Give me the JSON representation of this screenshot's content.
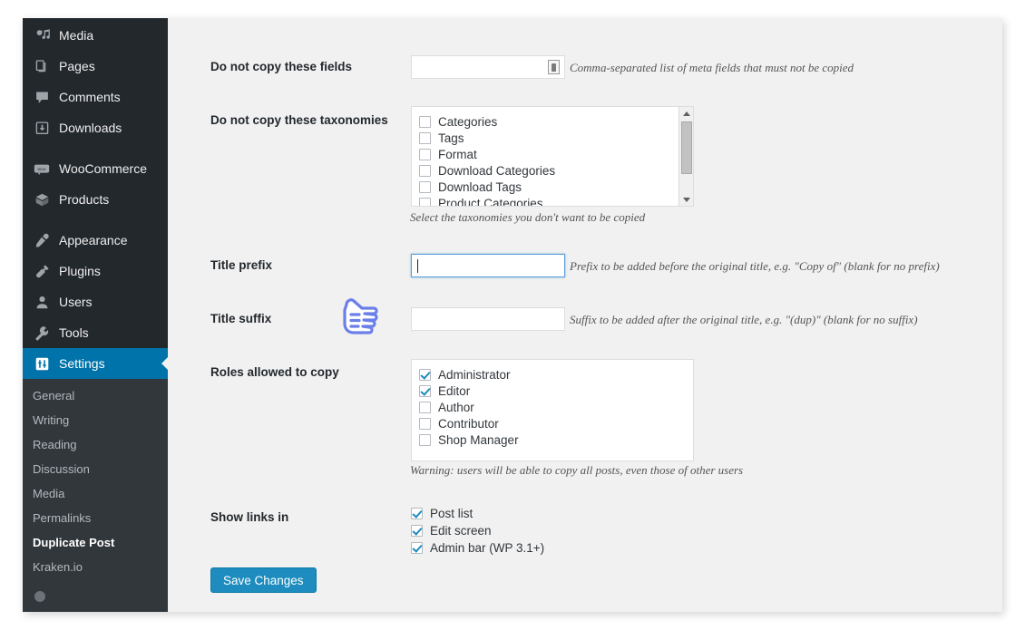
{
  "sidebar": {
    "items": [
      {
        "label": "Media",
        "icon": "media-icon"
      },
      {
        "label": "Pages",
        "icon": "pages-icon"
      },
      {
        "label": "Comments",
        "icon": "comments-icon"
      },
      {
        "label": "Downloads",
        "icon": "downloads-icon"
      },
      {
        "label": "WooCommerce",
        "icon": "woocommerce-icon"
      },
      {
        "label": "Products",
        "icon": "products-icon"
      },
      {
        "label": "Appearance",
        "icon": "appearance-icon"
      },
      {
        "label": "Plugins",
        "icon": "plugins-icon"
      },
      {
        "label": "Users",
        "icon": "users-icon"
      },
      {
        "label": "Tools",
        "icon": "tools-icon"
      },
      {
        "label": "Settings",
        "icon": "settings-icon"
      }
    ],
    "active_item": "Settings",
    "submenu": [
      "General",
      "Writing",
      "Reading",
      "Discussion",
      "Media",
      "Permalinks",
      "Duplicate Post",
      "Kraken.io"
    ],
    "submenu_current": "Duplicate Post",
    "accent_color": "#0073aa",
    "background_color": "#23282d",
    "submenu_background_color": "#32373c"
  },
  "form": {
    "fields": {
      "do_not_copy_fields": {
        "label": "Do not copy these fields",
        "value": "",
        "help": "Comma-separated list of meta fields that must not be copied",
        "widget": "spinner-icon"
      },
      "do_not_copy_taxonomies": {
        "label": "Do not copy these taxonomies",
        "help": "Select the taxonomies you don't want to be copied",
        "options": [
          {
            "label": "Categories",
            "checked": false
          },
          {
            "label": "Tags",
            "checked": false
          },
          {
            "label": "Format",
            "checked": false
          },
          {
            "label": "Download Categories",
            "checked": false
          },
          {
            "label": "Download Tags",
            "checked": false
          },
          {
            "label": "Product Categories",
            "checked": false
          }
        ]
      },
      "title_prefix": {
        "label": "Title prefix",
        "value": "",
        "focused": true,
        "help": "Prefix to be added before the original title, e.g. \"Copy of\" (blank for no prefix)"
      },
      "title_suffix": {
        "label": "Title suffix",
        "value": "",
        "focused": false,
        "help": "Suffix to be added after the original title, e.g. \"(dup)\" (blank for no suffix)"
      },
      "roles_allowed": {
        "label": "Roles allowed to copy",
        "help": "Warning: users will be able to copy all posts, even those of other users",
        "options": [
          {
            "label": "Administrator",
            "checked": true
          },
          {
            "label": "Editor",
            "checked": true
          },
          {
            "label": "Author",
            "checked": false
          },
          {
            "label": "Contributor",
            "checked": false
          },
          {
            "label": "Shop Manager",
            "checked": false
          }
        ]
      },
      "show_links_in": {
        "label": "Show links in",
        "options": [
          {
            "label": "Post list",
            "checked": true
          },
          {
            "label": "Edit screen",
            "checked": true
          },
          {
            "label": "Admin bar (WP 3.1+)",
            "checked": true
          }
        ]
      }
    },
    "save_button": "Save Changes",
    "save_button_color": "#1e8cbe"
  },
  "cursor": {
    "icon": "pointing-hand-cursor",
    "color": "#6b7fe8"
  }
}
